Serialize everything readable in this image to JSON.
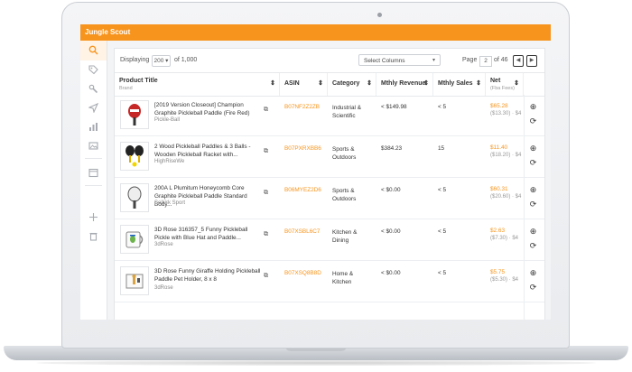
{
  "app": {
    "name": "Jungle Scout"
  },
  "colors": {
    "accent": "#f7941d",
    "rowBorder": "#eceef1"
  },
  "sidebar": {
    "icons": [
      "search-icon",
      "tag-icon",
      "wrench-icon",
      "send-icon",
      "bar-chart-icon",
      "image-icon",
      "window-icon",
      "move-icon",
      "trash-icon"
    ]
  },
  "toolbar": {
    "displaying_label": "Displaying",
    "per_page": "200 ▾",
    "of_total": "of 1,000",
    "select_columns": "Select Columns",
    "page_label": "Page",
    "page_current": "2",
    "page_of": "of 46",
    "prev": "◀",
    "next": "▶"
  },
  "table": {
    "columns": [
      {
        "label": "Product Title",
        "sub": "Brand"
      },
      {
        "label": "ASIN",
        "sub": ""
      },
      {
        "label": "Category",
        "sub": ""
      },
      {
        "label": "Mthly Revenue",
        "sub": ""
      },
      {
        "label": "Mthly Sales",
        "sub": ""
      },
      {
        "label": "Net",
        "sub": "(Fba Fees)"
      }
    ],
    "rows": [
      {
        "title": "[2019 Version Closeout] Champion Graphite Pickleball Paddle (Fire Red)",
        "brand": "Pickle-Ball",
        "asin": "B07NF2Z2ZB",
        "category": "Industrial & Scientific",
        "revenue": "< $149.98",
        "sales": "< 5",
        "net": "$65.28",
        "fees": "($13.30) · $4"
      },
      {
        "title": "2 Wood Pickleball Paddles & 3 Balls - Wooden Pickleball Racket with...",
        "brand": "HighRiseWe",
        "asin": "B07PXRXBB6",
        "category": "Sports & Outdoors",
        "revenue": "$384.23",
        "sales": "15",
        "net": "$11.40",
        "fees": "($18.20) · $4"
      },
      {
        "title": "200A L Plumitum Honeycomb Core Graphite Pickleball Paddle Standard Body...",
        "brand": "Selkirk Sport",
        "asin": "B06MYEZ2D6",
        "category": "Sports & Outdoors",
        "revenue": "< $0.00",
        "sales": "< 5",
        "net": "$60.31",
        "fees": "($20.60) · $4"
      },
      {
        "title": "3D Rose 316357_5 Funny Pickleball Pickle with Blue Hat and Paddle...",
        "brand": "3dRose",
        "asin": "B07XSBL6C7",
        "category": "Kitchen & Dining",
        "revenue": "< $0.00",
        "sales": "< 5",
        "net": "$2.63",
        "fees": "($7.30) · $4"
      },
      {
        "title": "3D Rose Funny Giraffe Holding Pickleball Paddle Pet Holder, 8 x 8",
        "brand": "3dRose",
        "asin": "B07XSQ8B8D",
        "category": "Home & Kitchen",
        "revenue": "< $0.00",
        "sales": "< 5",
        "net": "$5.75",
        "fees": "($5.30) · $4"
      }
    ]
  }
}
